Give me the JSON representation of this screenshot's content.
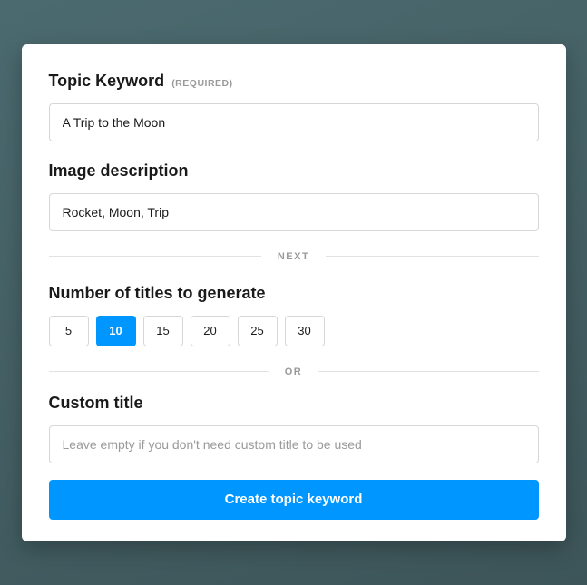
{
  "topic": {
    "label": "Topic Keyword",
    "required_tag": "(REQUIRED)",
    "value": "A Trip to the Moon"
  },
  "image_desc": {
    "label": "Image description",
    "value": "Rocket, Moon, Trip"
  },
  "dividers": {
    "next": "NEXT",
    "or": "OR"
  },
  "titles_count": {
    "label": "Number of titles to generate",
    "options": [
      "5",
      "10",
      "15",
      "20",
      "25",
      "30"
    ],
    "selected": "10"
  },
  "custom_title": {
    "label": "Custom title",
    "placeholder": "Leave empty if you don't need custom title to be used",
    "value": ""
  },
  "submit": {
    "label": "Create topic keyword"
  },
  "colors": {
    "accent": "#0096ff"
  }
}
